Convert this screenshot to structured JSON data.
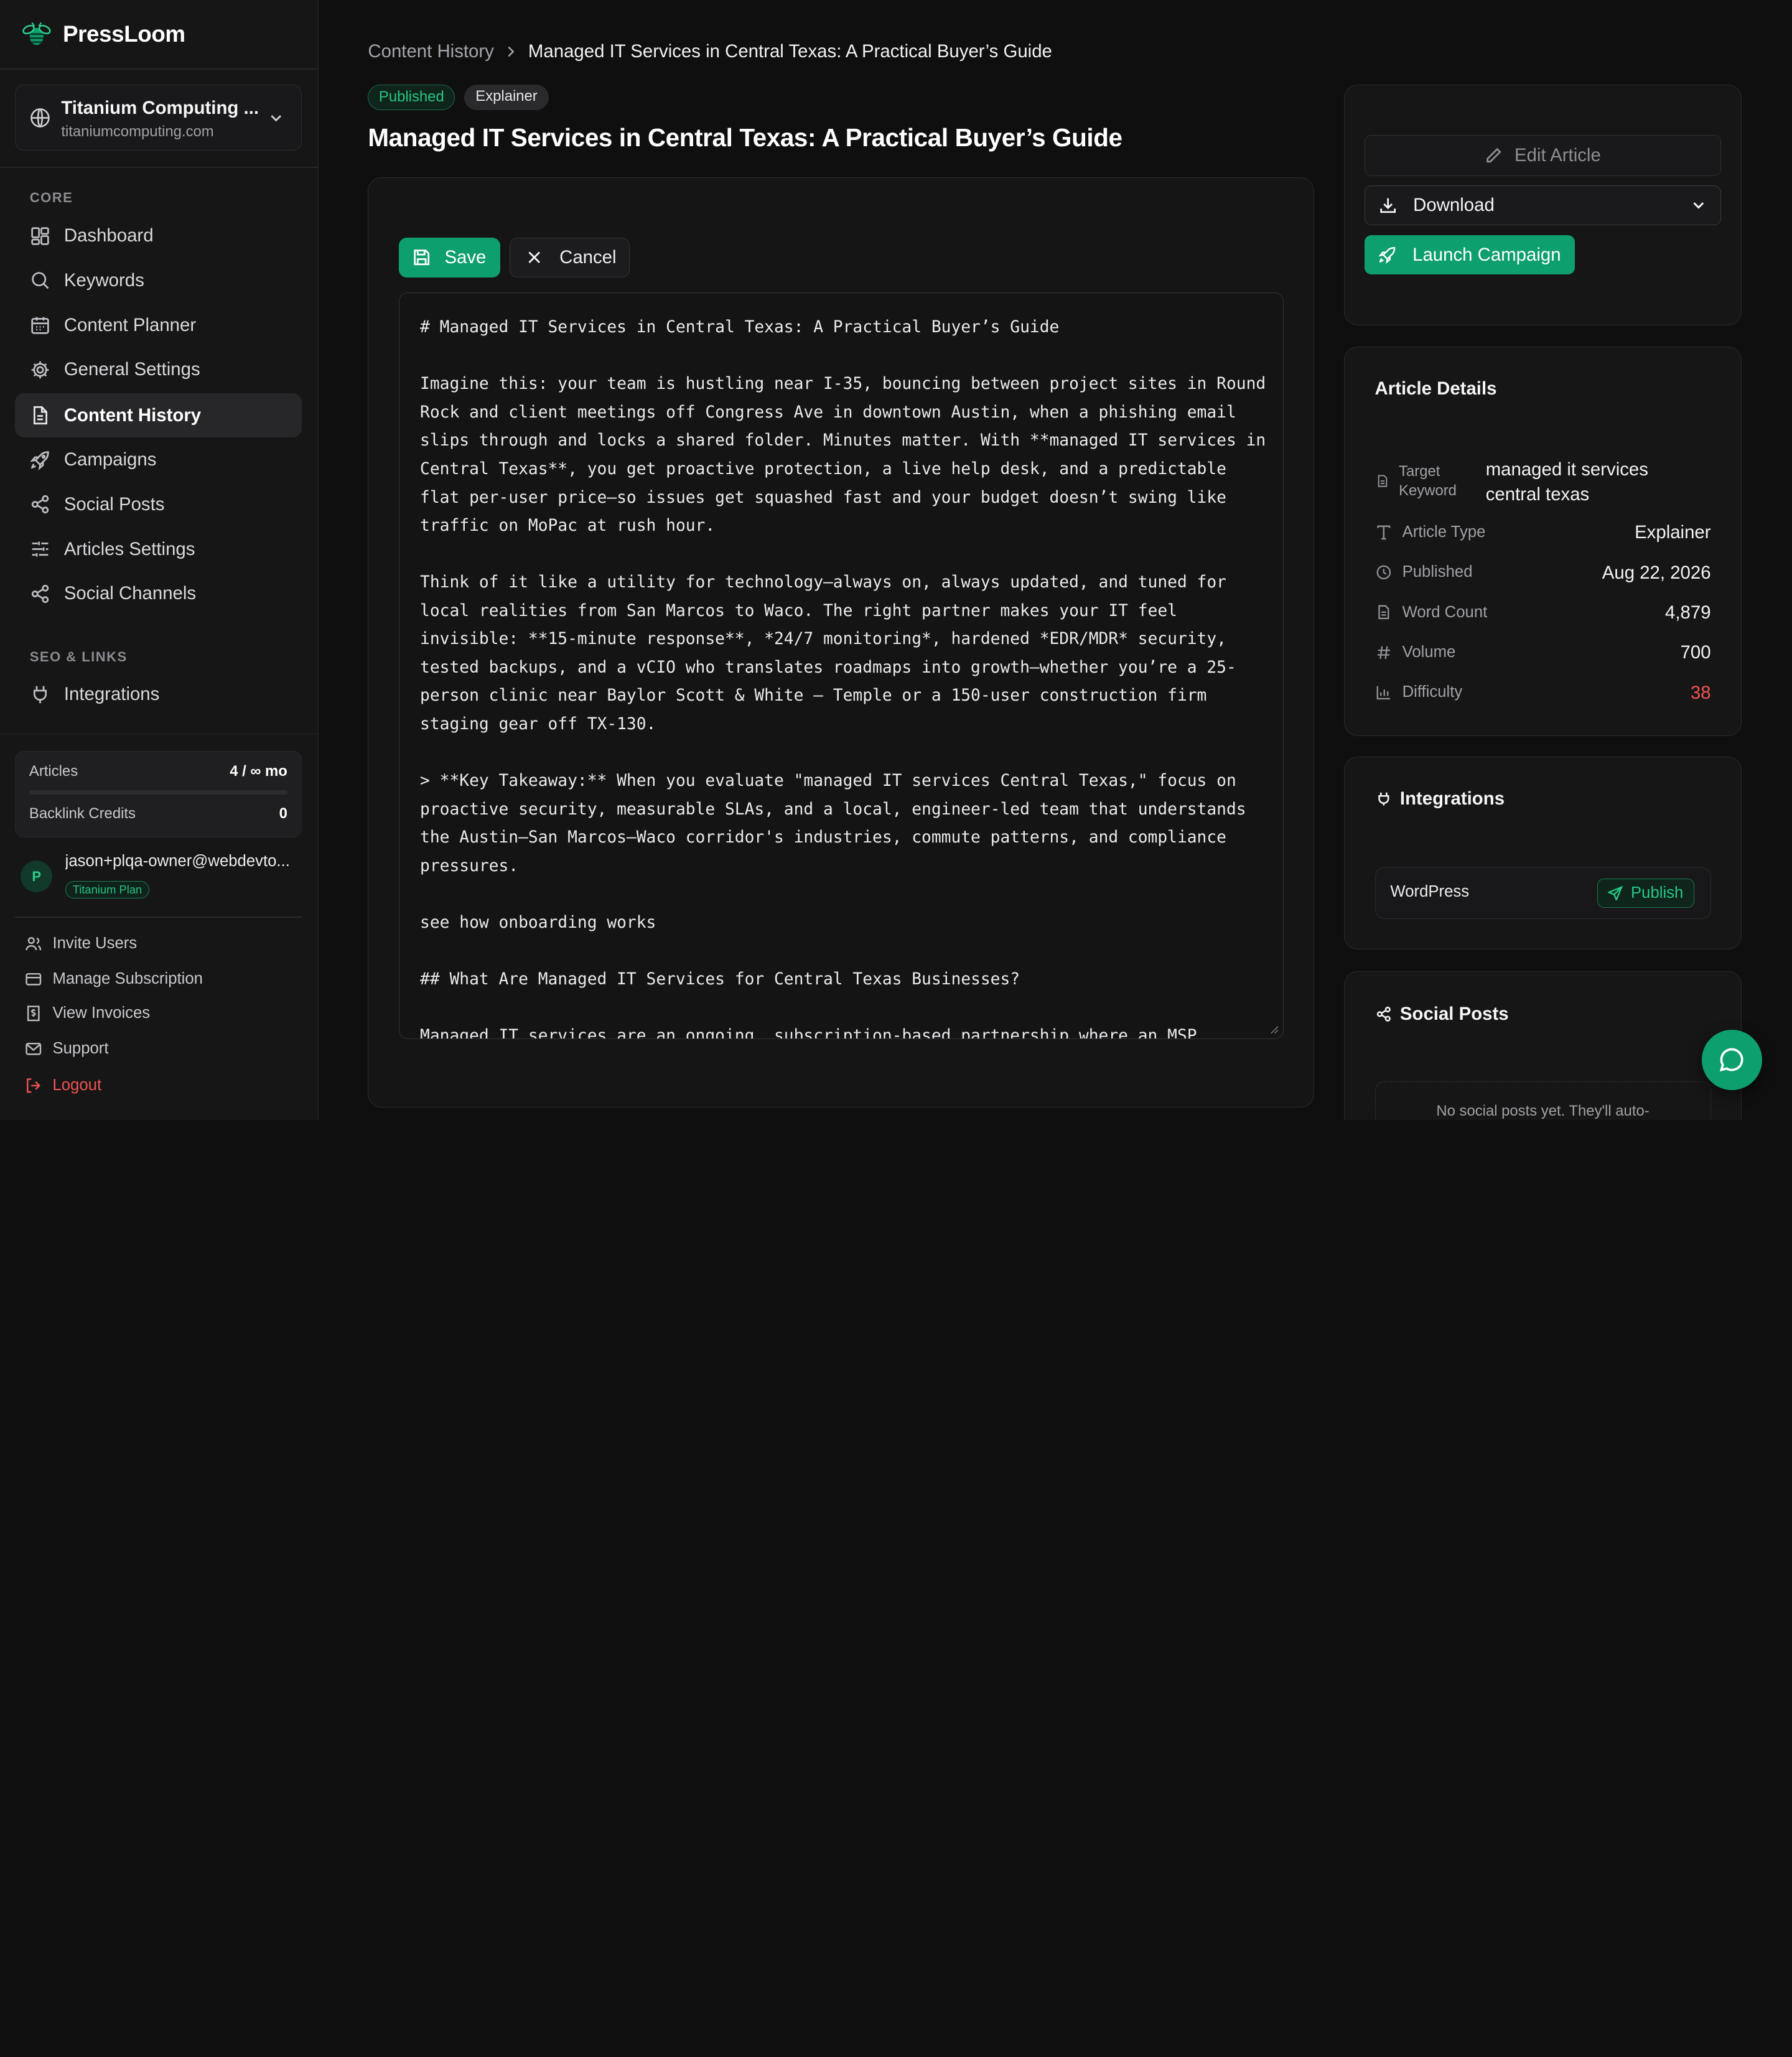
{
  "brand": {
    "name": "PressLoom",
    "logo_icon": "bee-logo-icon",
    "accent": "#0e9f6e"
  },
  "site": {
    "name": "Titanium Computing ...",
    "domain": "titaniumcomputing.com"
  },
  "nav": {
    "core_label": "CORE",
    "core_items": [
      {
        "label": "Dashboard",
        "icon": "dashboard-icon"
      },
      {
        "label": "Keywords",
        "icon": "search-icon"
      },
      {
        "label": "Content Planner",
        "icon": "calendar-icon"
      },
      {
        "label": "General Settings",
        "icon": "gear-icon"
      },
      {
        "label": "Content History",
        "icon": "document-icon",
        "active": true
      },
      {
        "label": "Campaigns",
        "icon": "rocket-icon"
      },
      {
        "label": "Social Posts",
        "icon": "share-icon"
      },
      {
        "label": "Articles Settings",
        "icon": "sliders-icon"
      },
      {
        "label": "Social Channels",
        "icon": "share-icon"
      }
    ],
    "seo_label": "SEO & LINKS",
    "seo_items": [
      {
        "label": "Integrations",
        "icon": "plug-icon"
      }
    ]
  },
  "usage": {
    "articles_label": "Articles",
    "articles_value": "4 / ∞ mo",
    "backlinks_label": "Backlink Credits",
    "backlinks_value": "0"
  },
  "user": {
    "initial": "P",
    "email": "jason+plqa-owner@webdevto...",
    "plan": "Titanium Plan"
  },
  "footer_links": {
    "invite": "Invite Users",
    "subscription": "Manage Subscription",
    "invoices": "View Invoices",
    "support": "Support",
    "logout": "Logout"
  },
  "breadcrumb": {
    "parent": "Content History",
    "current": "Managed IT Services in Central Texas: A Practical Buyer’s Guide"
  },
  "article": {
    "status": "Published",
    "type_badge": "Explainer",
    "title": "Managed IT Services in Central Texas: A Practical Buyer’s Guide",
    "markdown": "# Managed IT Services in Central Texas: A Practical Buyer’s Guide\n\nImagine this: your team is hustling near I-35, bouncing between project sites in Round Rock and client meetings off Congress Ave in downtown Austin, when a phishing email slips through and locks a shared folder. Minutes matter. With **managed IT services in Central Texas**, you get proactive protection, a live help desk, and a predictable flat per-user price—so issues get squashed fast and your budget doesn’t swing like traffic on MoPac at rush hour.\n\nThink of it like a utility for technology—always on, always updated, and tuned for local realities from San Marcos to Waco. The right partner makes your IT feel invisible: **15-minute response**, *24/7 monitoring*, hardened *EDR/MDR* security, tested backups, and a vCIO who translates roadmaps into growth—whether you’re a 25-person clinic near Baylor Scott & White – Temple or a 150-user construction firm staging gear off TX-130.\n\n> **Key Takeaway:** When you evaluate \"managed IT services Central Texas,\" focus on proactive security, measurable SLAs, and a local, engineer-led team that understands the Austin–San Marcos–Waco corridor's industries, commute patterns, and compliance pressures.\n\nsee how onboarding works\n\n## What Are Managed IT Services for Central Texas Businesses?\n\nManaged IT services are an ongoing, subscription-based partnership where an MSP"
  },
  "editor": {
    "save_label": "Save",
    "cancel_label": "Cancel"
  },
  "actions": {
    "edit_label": "Edit Article",
    "download_label": "Download",
    "launch_label": "Launch Campaign"
  },
  "details": {
    "title": "Article Details",
    "target_keyword_label": "Target Keyword",
    "target_keyword_value": "managed it services central texas",
    "rows": [
      {
        "label": "Article Type",
        "value": "Explainer",
        "icon": "type-icon"
      },
      {
        "label": "Published",
        "value": "Aug 22, 2026",
        "icon": "clock-icon"
      },
      {
        "label": "Word Count",
        "value": "4,879",
        "icon": "document-icon"
      },
      {
        "label": "Volume",
        "value": "700",
        "icon": "hash-icon"
      },
      {
        "label": "Difficulty",
        "value": "38",
        "icon": "bar-chart-icon"
      }
    ]
  },
  "integrations": {
    "title": "Integrations",
    "platform": "WordPress",
    "publish_label": "Publish"
  },
  "social": {
    "title": "Social Posts",
    "empty_text": "No social posts yet. They'll auto-"
  }
}
